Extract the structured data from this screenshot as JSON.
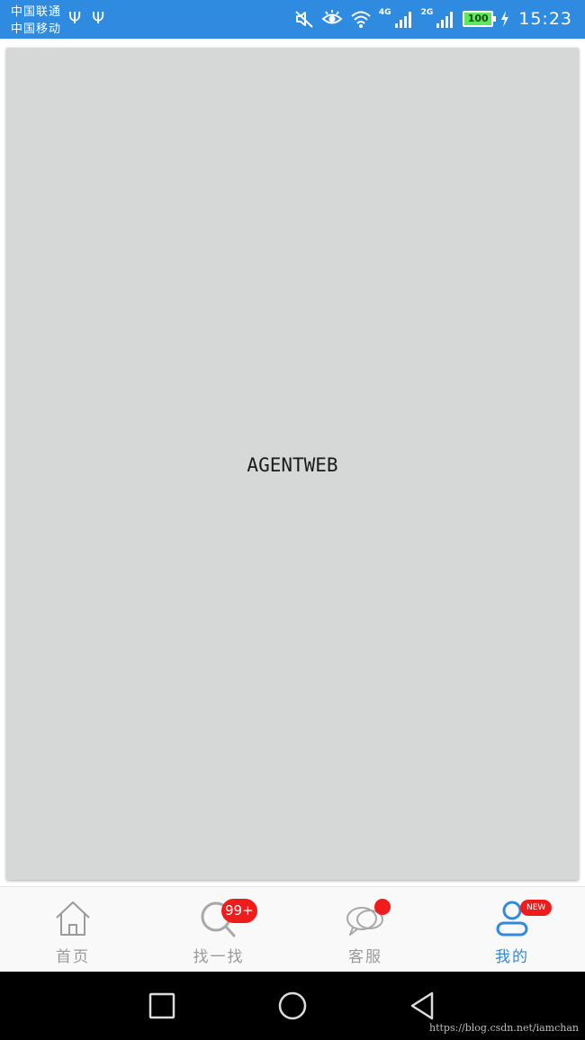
{
  "status_bar": {
    "carriers": [
      "中国联通",
      "中国移动"
    ],
    "network_4g": "4G",
    "network_2g": "2G",
    "battery": "100",
    "time": "15:23",
    "color": "#2f8be0"
  },
  "content": {
    "brand_text": "AGENTWEB",
    "background": "#d6d8d8"
  },
  "tab_bar": {
    "tabs": [
      {
        "label": "首页",
        "icon": "home-icon",
        "active": false
      },
      {
        "label": "找一找",
        "icon": "search-icon",
        "active": false,
        "badge": "99+"
      },
      {
        "label": "客服",
        "icon": "chat-icon",
        "active": false,
        "dot": true
      },
      {
        "label": "我的",
        "icon": "profile-icon",
        "active": true,
        "badge": "NEW"
      }
    ],
    "active_color": "#2f8be0",
    "inactive_color": "#9a9a9a",
    "badge_color": "#f01c1c"
  },
  "nav_bar": {
    "buttons": [
      "recent-apps-button",
      "home-button",
      "back-button"
    ]
  },
  "watermark": "https://blog.csdn.net/iamchan"
}
